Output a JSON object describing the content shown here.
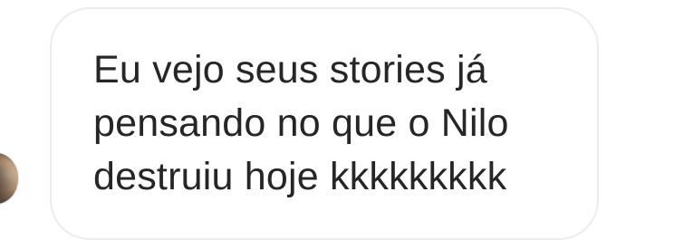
{
  "message": {
    "lines": [
      "Eu vejo seus stories já",
      "pensando no que o Nilo",
      "destruiu hoje kkkkkkkkk"
    ]
  },
  "colors": {
    "text": "#262626",
    "bubble_border": "#ececec",
    "background": "#ffffff"
  }
}
